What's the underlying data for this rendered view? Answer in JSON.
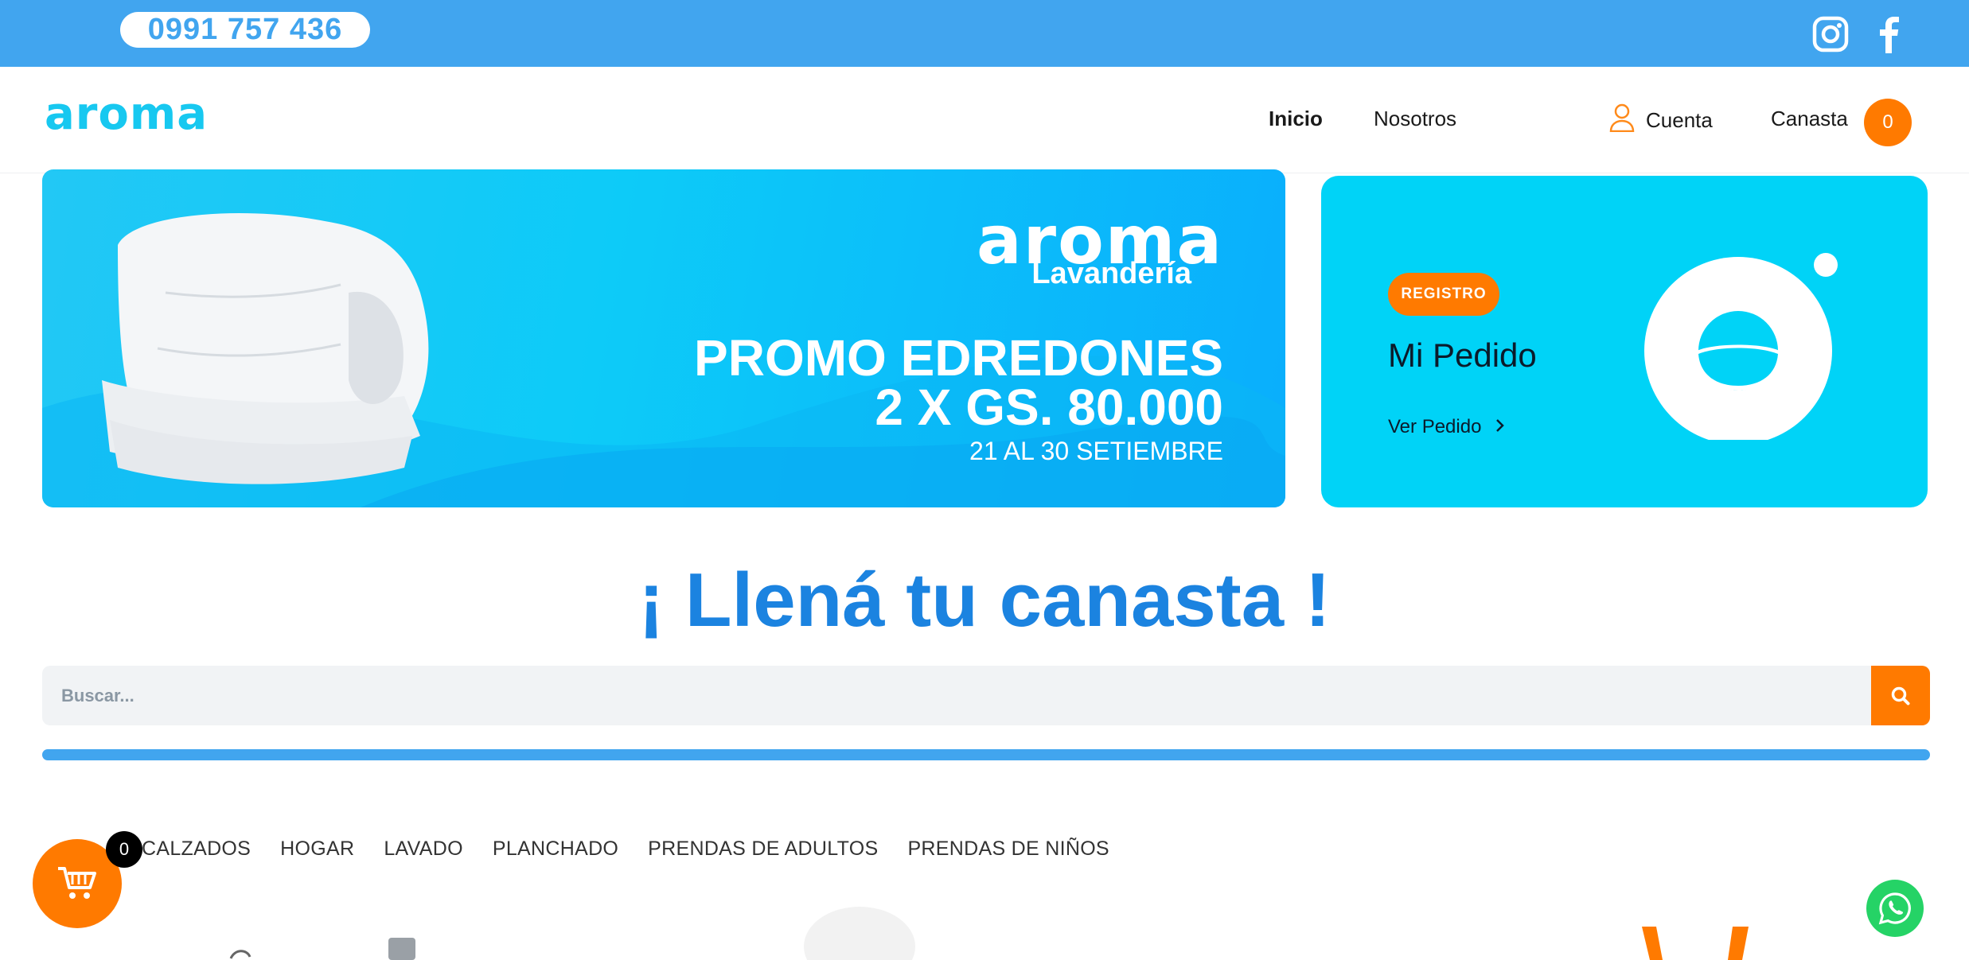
{
  "topbar": {
    "phone": "0991 757 436",
    "social": [
      "instagram-icon",
      "facebook-icon"
    ]
  },
  "header": {
    "logo_text": "aroma",
    "nav": [
      {
        "label": "Inicio",
        "active": true
      },
      {
        "label": "Nosotros",
        "active": false
      }
    ],
    "account_label": "Cuenta",
    "cart_label": "Canasta",
    "cart_count": "0"
  },
  "banner": {
    "brand": "aroma",
    "subtitle": "Lavandería",
    "promo_line1": "PROMO EDREDONES",
    "promo_line2": "2 X GS. 80.000",
    "dates": "21 AL 30 SETIEMBRE"
  },
  "side_card": {
    "badge": "REGISTRO",
    "title": "Mi Pedido",
    "link": "Ver Pedido"
  },
  "headline": "¡ Llená tu canasta !",
  "search": {
    "placeholder": "Buscar..."
  },
  "categories": [
    "CALZADOS",
    "HOGAR",
    "LAVADO",
    "PLANCHADO",
    "PRENDAS DE ADULTOS",
    "PRENDAS DE NIÑOS"
  ],
  "floating_cart": {
    "count": "0"
  },
  "colors": {
    "primary_blue": "#41a5ef",
    "cyan": "#00d3f7",
    "orange": "#ff7a00",
    "headline_blue": "#1b83e0",
    "whatsapp_green": "#25d366"
  }
}
